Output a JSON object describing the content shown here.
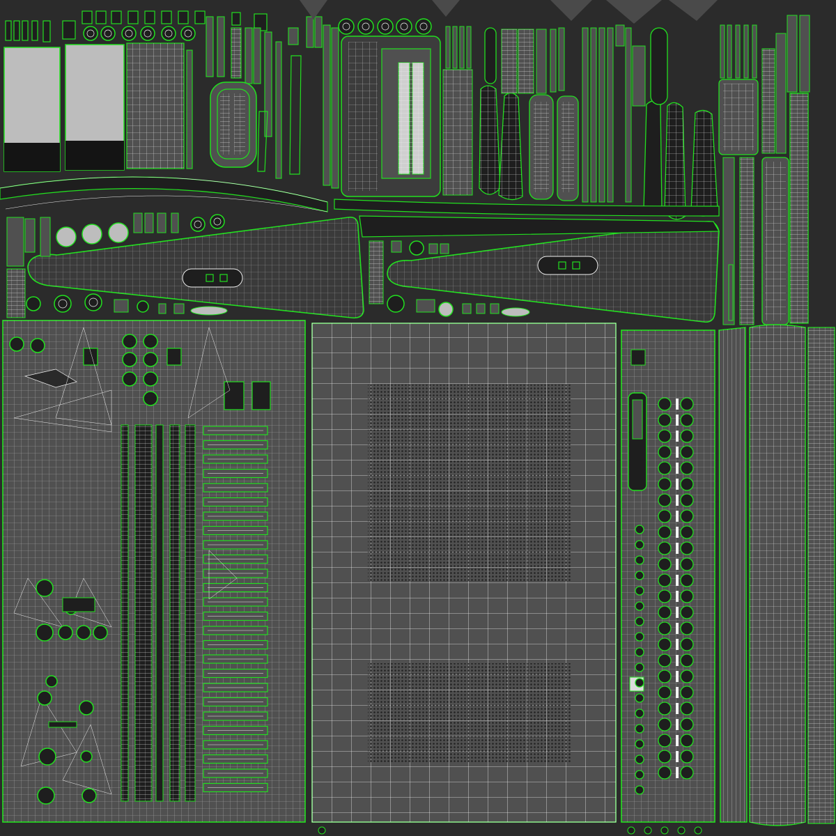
{
  "texture_sheet": {
    "kind": "UV layout wireframe",
    "colors": {
      "background": "#2b2b2b",
      "island_fill": "#505050",
      "island_fill_dark": "#1e1e1e",
      "seam_green": "#22e01f",
      "wire_white": "#f2f2f2",
      "swatch_light": "#bdbdbd",
      "swatch_dark": "#141414",
      "dot_pattern": "#1a1a1a"
    },
    "regions": [
      "top-strip-islands",
      "left-handle-panel",
      "right-handle-panel",
      "bottom-left-keyboard-panel",
      "center-grille-panel",
      "right-column-panel",
      "far-right-side-panel"
    ],
    "visible_text": []
  }
}
